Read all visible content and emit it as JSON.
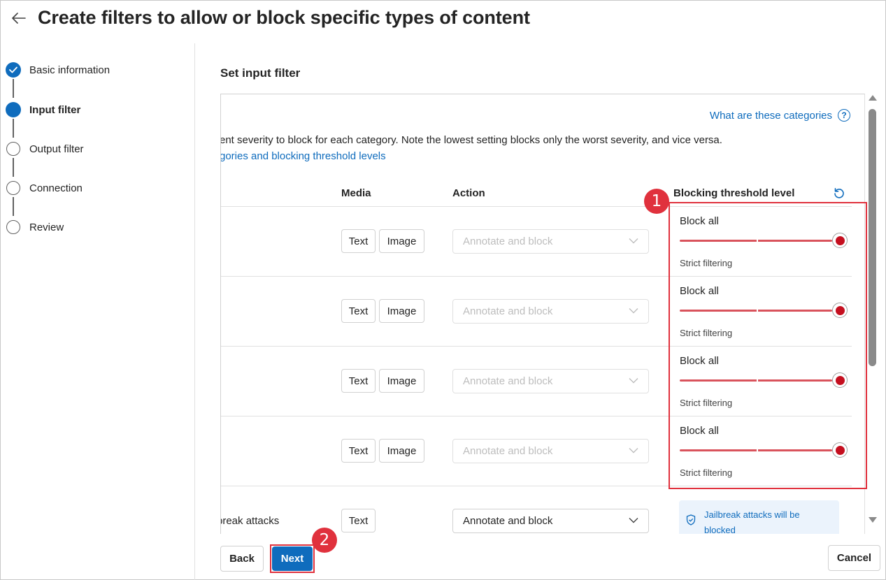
{
  "header": {
    "title": "Create filters to allow or block specific types of content"
  },
  "stepper": {
    "steps": [
      {
        "label": "Basic information",
        "state": "done"
      },
      {
        "label": "Input filter",
        "state": "current"
      },
      {
        "label": "Output filter",
        "state": "todo"
      },
      {
        "label": "Connection",
        "state": "todo"
      },
      {
        "label": "Review",
        "state": "todo"
      }
    ]
  },
  "main": {
    "section_title": "Set input filter",
    "what_link": "What are these categories",
    "description": "ent severity to block for each category. Note the lowest setting blocks only the worst severity, and vice versa.",
    "description_link": "gories and blocking threshold levels",
    "columns": {
      "media": "Media",
      "action": "Action",
      "threshold": "Blocking threshold level"
    },
    "rows": [
      {
        "media": [
          "Text",
          "Image"
        ],
        "action": "Annotate and block",
        "threshold_label": "Block all",
        "threshold_hint": "Strict filtering",
        "threshold_level": 1.0
      },
      {
        "media": [
          "Text",
          "Image"
        ],
        "action": "Annotate and block",
        "threshold_label": "Block all",
        "threshold_hint": "Strict filtering",
        "threshold_level": 1.0
      },
      {
        "media": [
          "Text",
          "Image"
        ],
        "action": "Annotate and block",
        "threshold_label": "Block all",
        "threshold_hint": "Strict filtering",
        "threshold_level": 1.0
      },
      {
        "media": [
          "Text",
          "Image"
        ],
        "action": "Annotate and block",
        "threshold_label": "Block all",
        "threshold_hint": "Strict filtering",
        "threshold_level": 1.0
      }
    ],
    "jailbreak_row": {
      "label": "break attacks",
      "media": "Text",
      "action": "Annotate and block",
      "info": "Jailbreak attacks will be blocked"
    }
  },
  "annotations": {
    "badge_1": "1",
    "badge_2": "2"
  },
  "footer": {
    "back": "Back",
    "next": "Next",
    "cancel": "Cancel"
  },
  "colors": {
    "accent": "#0f6cbd",
    "slider": "#d9535c",
    "slider_thumb": "#c50f1f",
    "annotation": "#e0313d"
  }
}
